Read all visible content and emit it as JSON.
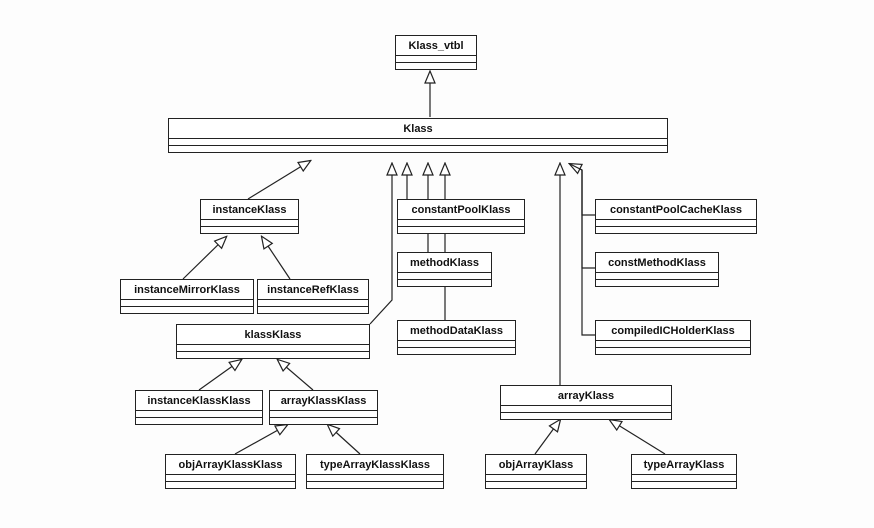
{
  "diagram": {
    "type": "uml-class-inheritance",
    "classes": {
      "root": {
        "label": "Klass_vtbl"
      },
      "klass": {
        "label": "Klass"
      },
      "instanceKlass": {
        "label": "instanceKlass"
      },
      "constantPoolKlass": {
        "label": "constantPoolKlass"
      },
      "constantPoolCacheKlass": {
        "label": "constantPoolCacheKlass"
      },
      "methodKlass": {
        "label": "methodKlass"
      },
      "constMethodKlass": {
        "label": "constMethodKlass"
      },
      "methodDataKlass": {
        "label": "methodDataKlass"
      },
      "compiledICHolderKlass": {
        "label": "compiledICHolderKlass"
      },
      "instanceMirrorKlass": {
        "label": "instanceMirrorKlass"
      },
      "instanceRefKlass": {
        "label": "instanceRefKlass"
      },
      "klassKlass": {
        "label": "klassKlass"
      },
      "instanceKlassKlass": {
        "label": "instanceKlassKlass"
      },
      "arrayKlassKlass": {
        "label": "arrayKlassKlass"
      },
      "objArrayKlassKlass": {
        "label": "objArrayKlassKlass"
      },
      "typeArrayKlassKlass": {
        "label": "typeArrayKlassKlass"
      },
      "arrayKlass": {
        "label": "arrayKlass"
      },
      "objArrayKlass": {
        "label": "objArrayKlass"
      },
      "typeArrayKlass": {
        "label": "typeArrayKlass"
      }
    },
    "inheritance": [
      [
        "klass",
        "root"
      ],
      [
        "instanceKlass",
        "klass"
      ],
      [
        "constantPoolKlass",
        "klass"
      ],
      [
        "constantPoolCacheKlass",
        "klass"
      ],
      [
        "methodKlass",
        "klass"
      ],
      [
        "constMethodKlass",
        "klass"
      ],
      [
        "methodDataKlass",
        "klass"
      ],
      [
        "compiledICHolderKlass",
        "klass"
      ],
      [
        "klassKlass",
        "klass"
      ],
      [
        "arrayKlass",
        "klass"
      ],
      [
        "instanceMirrorKlass",
        "instanceKlass"
      ],
      [
        "instanceRefKlass",
        "instanceKlass"
      ],
      [
        "instanceKlassKlass",
        "klassKlass"
      ],
      [
        "arrayKlassKlass",
        "klassKlass"
      ],
      [
        "objArrayKlassKlass",
        "arrayKlassKlass"
      ],
      [
        "typeArrayKlassKlass",
        "arrayKlassKlass"
      ],
      [
        "objArrayKlass",
        "arrayKlass"
      ],
      [
        "typeArrayKlass",
        "arrayKlass"
      ]
    ]
  }
}
